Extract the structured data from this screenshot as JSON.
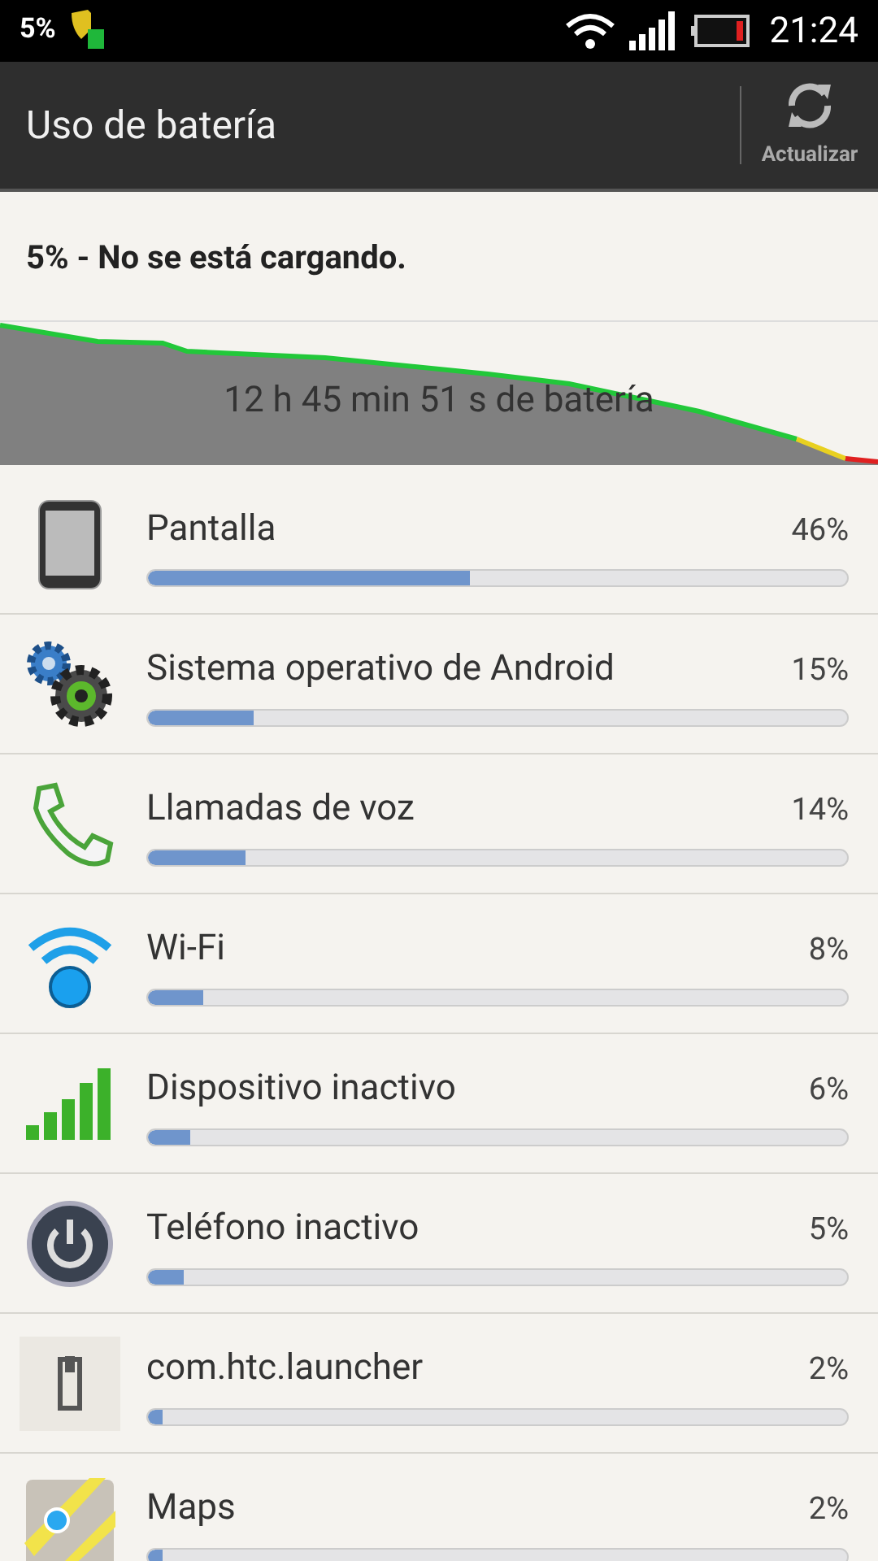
{
  "status_bar": {
    "battery_percent": "5%",
    "time": "21:24"
  },
  "action_bar": {
    "title": "Uso de batería",
    "refresh_label": "Actualizar"
  },
  "summary": "5% - No se está cargando.",
  "graph": {
    "caption": "12 h 45 min 51 s de batería"
  },
  "items": [
    {
      "kind": "screen",
      "name": "Pantalla",
      "percent": "46%",
      "level": 0.46
    },
    {
      "kind": "system",
      "name": "Sistema operativo de Android",
      "percent": "15%",
      "level": 0.15
    },
    {
      "kind": "call",
      "name": "Llamadas de voz",
      "percent": "14%",
      "level": 0.14
    },
    {
      "kind": "wifi",
      "name": "Wi-Fi",
      "percent": "8%",
      "level": 0.08
    },
    {
      "kind": "cell",
      "name": "Dispositivo inactivo",
      "percent": "6%",
      "level": 0.06
    },
    {
      "kind": "power",
      "name": "Teléfono inactivo",
      "percent": "5%",
      "level": 0.05
    },
    {
      "kind": "app",
      "name": "com.htc.launcher",
      "percent": "2%",
      "level": 0.02
    },
    {
      "kind": "maps",
      "name": "Maps",
      "percent": "2%",
      "level": 0.02
    }
  ]
}
